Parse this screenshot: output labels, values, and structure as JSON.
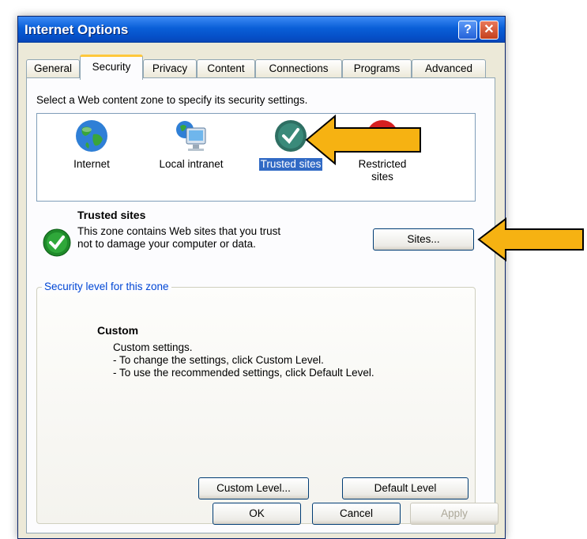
{
  "window": {
    "title": "Internet Options"
  },
  "tabs": [
    {
      "label": "General"
    },
    {
      "label": "Security"
    },
    {
      "label": "Privacy"
    },
    {
      "label": "Content"
    },
    {
      "label": "Connections"
    },
    {
      "label": "Programs"
    },
    {
      "label": "Advanced"
    }
  ],
  "active_tab": "Security",
  "security": {
    "intro": "Select a Web content zone to specify its security settings.",
    "zones": [
      {
        "label": "Internet",
        "icon": "globe-icon"
      },
      {
        "label": "Local intranet",
        "icon": "computer-globe-icon"
      },
      {
        "label": "Trusted sites",
        "icon": "checkmark-icon",
        "selected": true
      },
      {
        "label_line1": "Restricted",
        "label_line2": "sites",
        "icon": "no-entry-icon"
      }
    ],
    "selected_zone": {
      "title": "Trusted sites",
      "description": "This zone contains Web sites that you trust not to damage your computer or data.",
      "sites_button": "Sites..."
    },
    "level_group": {
      "legend": "Security level for this zone",
      "level_title": "Custom",
      "lines": [
        "Custom settings.",
        "- To change the settings, click Custom Level.",
        "- To use the recommended settings, click Default Level."
      ],
      "custom_level_button": "Custom Level...",
      "default_level_button": "Default Level"
    }
  },
  "footer": {
    "ok": "OK",
    "cancel": "Cancel",
    "apply": "Apply"
  },
  "colors": {
    "titlebar": "#0a5fd8",
    "arrow": "#f6b212",
    "selection": "#316ac5",
    "legend": "#0046d5"
  }
}
